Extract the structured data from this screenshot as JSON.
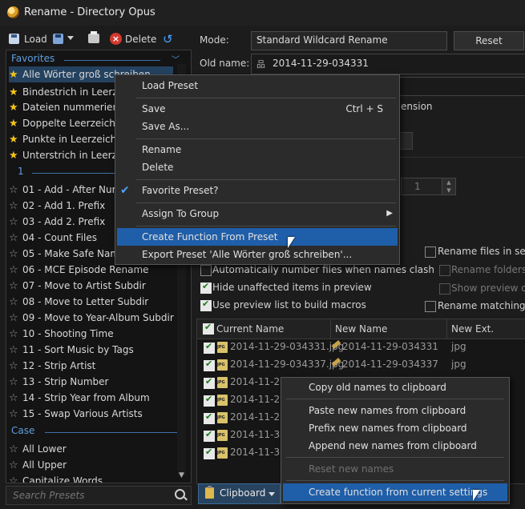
{
  "window": {
    "title": "Rename - Directory Opus"
  },
  "toolbar": {
    "load_label": "Load",
    "delete_label": "Delete"
  },
  "sidebar": {
    "favorites_header": "Favorites",
    "favorites": [
      "Alle Wörter groß schreiben",
      "Bindestrich in Leerzeic",
      "Dateien nummerieren",
      "Doppelte Leerzeichen",
      "Punkte in Leerzeichen",
      "Unterstrich in Leerzeic"
    ],
    "group1_header": "1",
    "group1": [
      "01 - Add - After Numb",
      "02 - Add 1. Prefix",
      "03 - Add 2. Prefix",
      "04 - Count Files",
      "05 - Make Safe Name",
      "06 - MCE Episode Rename",
      "07 - Move to Artist Subdir",
      "08 - Move to Letter Subdir",
      "09 - Move to Year-Album Subdir",
      "10 - Shooting Time",
      "11 - Sort Music by Tags",
      "12 - Strip Artist",
      "13 - Strip Number",
      "14 - Strip Year from Album",
      "15 - Swap Various Artists"
    ],
    "case_header": "Case",
    "case": [
      "All Lower",
      "All Upper",
      "Capitalize Words"
    ],
    "search_placeholder": "Search Presets"
  },
  "main": {
    "mode_label": "Mode:",
    "mode_value": "Standard Wildcard Rename",
    "reset_label": "Reset",
    "oldname_label": "Old name:",
    "oldname_value": "2014-11-29-034331",
    "extension_text": "ension",
    "spin_value": "1",
    "options": {
      "rename_files_in_selec": "Rename files in selec",
      "rename_folders": "Rename folders a",
      "show_preview": "Show preview of s",
      "auto_number": "Automatically number files when names clash",
      "hide_unaffected": "Hide unaffected items in preview",
      "use_preview_list": "Use preview list to build macros",
      "rename_matching": "Rename matching fil"
    }
  },
  "file_list": {
    "columns": [
      "Current Name",
      "New Name",
      "New Ext."
    ],
    "rows": [
      {
        "current": "2014-11-29-034331.jpg",
        "new": "2014-11-29-034331",
        "ext": "jpg"
      },
      {
        "current": "2014-11-29-034337.jpg",
        "new": "2014-11-29-034337",
        "ext": "jpg"
      },
      {
        "current": "2014-11-29-",
        "new": "",
        "ext": ""
      },
      {
        "current": "2014-11-29-",
        "new": "",
        "ext": ""
      },
      {
        "current": "2014-11-29-",
        "new": "",
        "ext": ""
      },
      {
        "current": "2014-11-30-",
        "new": "",
        "ext": ""
      },
      {
        "current": "2014-11-30-",
        "new": "",
        "ext": ""
      }
    ]
  },
  "clipboard_button": {
    "label": "Clipboard"
  },
  "preset_menu": {
    "load_preset": "Load Preset",
    "save": "Save",
    "save_shortcut": "Ctrl + S",
    "save_as": "Save As...",
    "rename": "Rename",
    "delete": "Delete",
    "favorite_preset": "Favorite Preset?",
    "assign_to_group": "Assign To Group",
    "create_function": "Create Function From Preset",
    "export_preset": "Export Preset 'Alle Wörter groß schreiben'..."
  },
  "clipboard_menu": {
    "copy_old": "Copy old names to clipboard",
    "paste_new": "Paste new names from clipboard",
    "prefix_new": "Prefix new names from clipboard",
    "append_new": "Append new names from clipboard",
    "reset_new": "Reset new names",
    "create_function": "Create function from current settings"
  },
  "colors": {
    "accent": "#1f5ea8",
    "selection": "#24425f",
    "favorite_star": "#f5c518",
    "group_header": "#5f9fdf"
  }
}
